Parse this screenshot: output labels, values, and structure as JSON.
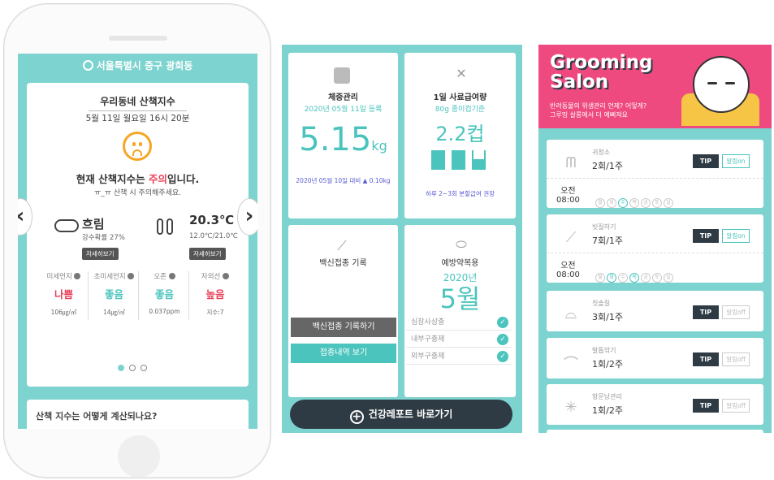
{
  "phone": {
    "location": "서울특별시 중구 광희동",
    "walk_title": "우리동네 산책지수",
    "datetime": "5월 11일 월요일 16시 20분",
    "status_prefix": "현재 산책지수는 ",
    "status_word": "주의",
    "status_suffix": "입니다.",
    "status_sub": "ㅠ_ㅠ 산책 시 주의해주세요.",
    "weather": "흐림",
    "rain_prob": "강수확률 27%",
    "temp": "20.3℃",
    "temp_range": "12.0℃/21.0℃",
    "detail_btn": "자세히보기",
    "arrow_left": "‹",
    "arrow_right": "›",
    "air": [
      {
        "name": "미세먼지",
        "level": "나쁨",
        "value": "106㎍/㎥",
        "color": "#e8415a"
      },
      {
        "name": "초미세먼지",
        "level": "좋음",
        "value": "14㎍/㎥",
        "color": "#4bc4bd"
      },
      {
        "name": "오존",
        "level": "좋음",
        "value": "0.037ppm",
        "color": "#4bc4bd"
      },
      {
        "name": "자외선",
        "level": "높음",
        "value": "지수:7",
        "color": "#e8415a"
      }
    ],
    "calc_question": "산책 지수는 어떻게 계산되나요?"
  },
  "health": {
    "weight_title": "체중관리",
    "weight_date": "2020년 05월 11일 등록",
    "weight_value": "5.15",
    "weight_unit": "kg",
    "weight_compare": "2020년 05월 10일 대비 ▲ 0.10kg",
    "feed_title": "1일 사료급여량",
    "feed_sub": "80g 종이컵기준",
    "feed_value": "2.2컵",
    "feed_note": "하루 2~3회 분할급여 권장",
    "vaccine_title": "백신접종 기록",
    "vaccine_btn": "백신접종 기록하기",
    "vaccine_history_btn": "접종내역 보기",
    "prevent_title": "예방약복용",
    "prevent_year": "2020년",
    "prevent_month": "5월",
    "prevent_items": [
      "심장사상충",
      "내부구충제",
      "외부구충제"
    ],
    "report_btn": "건강레포트 바로가기",
    "colors": {
      "accent": "#4bc4bd",
      "dark": "#2f3b44"
    }
  },
  "grooming": {
    "title_line1": "Grooming",
    "title_line2": "Salon",
    "sub1": "반려동물의 위생관리 언제? 어떻게?",
    "sub2": "그루밍 살롱에서 더 예뻐져요",
    "tip_label": "TIP",
    "items": [
      {
        "icon": "ear-icon",
        "name": "귀청소",
        "freq": "2회/1주",
        "alarm": "알림on",
        "time_ampm": "오전",
        "time": "08:00",
        "days": [
          "월",
          "화",
          "수",
          "목",
          "금",
          "토",
          "일"
        ],
        "on_days": [
          2
        ]
      },
      {
        "icon": "comb-icon",
        "name": "빗질하기",
        "freq": "7회/1주",
        "alarm": "알림on",
        "time_ampm": "오전",
        "time": "08:00",
        "days": [
          "월",
          "화",
          "수",
          "목",
          "금",
          "토",
          "일"
        ],
        "on_days": [
          1,
          3
        ]
      },
      {
        "icon": "toothbrush-icon",
        "name": "칫솔질",
        "freq": "3회/1주",
        "alarm": "알림off"
      },
      {
        "icon": "nail-icon",
        "name": "발톱깎기",
        "freq": "1회/2주",
        "alarm": "알림off"
      },
      {
        "icon": "anal-gland-icon",
        "name": "항문낭관리",
        "freq": "1회/2주",
        "alarm": "알림off"
      }
    ],
    "colors": {
      "banner": "#ef4a80"
    }
  }
}
